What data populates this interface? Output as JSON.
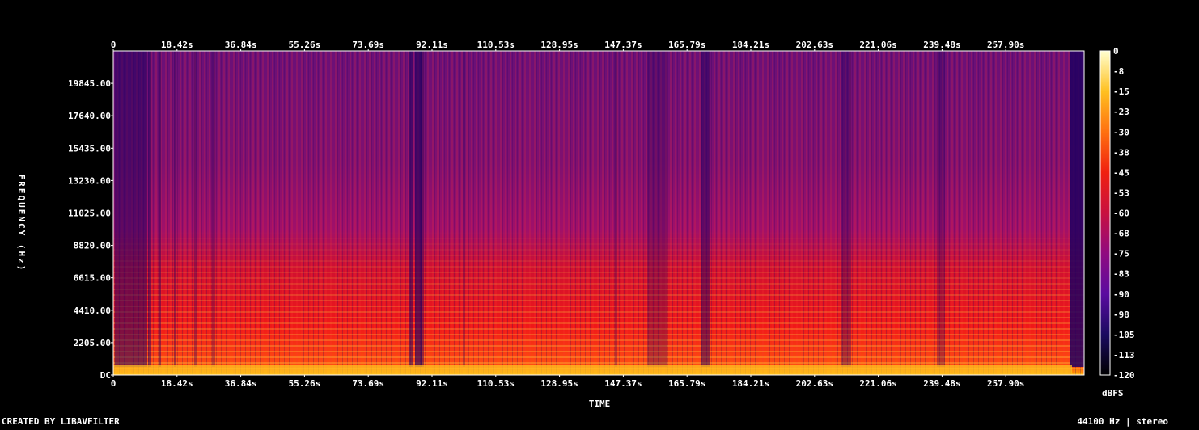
{
  "chart_data": {
    "type": "heatmap",
    "title": "",
    "xlabel": "TIME",
    "ylabel": "FREQUENCY (Hz)",
    "x_ticks": [
      "0",
      "18.42s",
      "36.84s",
      "55.26s",
      "73.69s",
      "92.11s",
      "110.53s",
      "128.95s",
      "147.37s",
      "165.79s",
      "184.21s",
      "202.63s",
      "221.06s",
      "239.48s",
      "257.90s"
    ],
    "y_ticks": [
      "DC",
      "2205.00",
      "4410.00",
      "6615.00",
      "8820.00",
      "11025.00",
      "13230.00",
      "15435.00",
      "17640.00",
      "19845.00"
    ],
    "xlim": [
      0,
      276.3
    ],
    "ylim": [
      0,
      22050
    ],
    "colorbar": {
      "label": "dBFS",
      "ticks": [
        "0",
        "-8",
        "-15",
        "-23",
        "-30",
        "-38",
        "-45",
        "-53",
        "-60",
        "-68",
        "-75",
        "-83",
        "-90",
        "-98",
        "-105",
        "-113",
        "-120"
      ],
      "range": [
        -120,
        0
      ],
      "colors": [
        "#000000",
        "#1a0a60",
        "#5a0aa0",
        "#900a80",
        "#c81040",
        "#f02010",
        "#ff7010",
        "#ffc020",
        "#ffffd0"
      ]
    },
    "legend": "right",
    "grid": false
  },
  "footer": {
    "left": "CREATED BY LIBAVFILTER",
    "right": "44100 Hz | stereo"
  }
}
